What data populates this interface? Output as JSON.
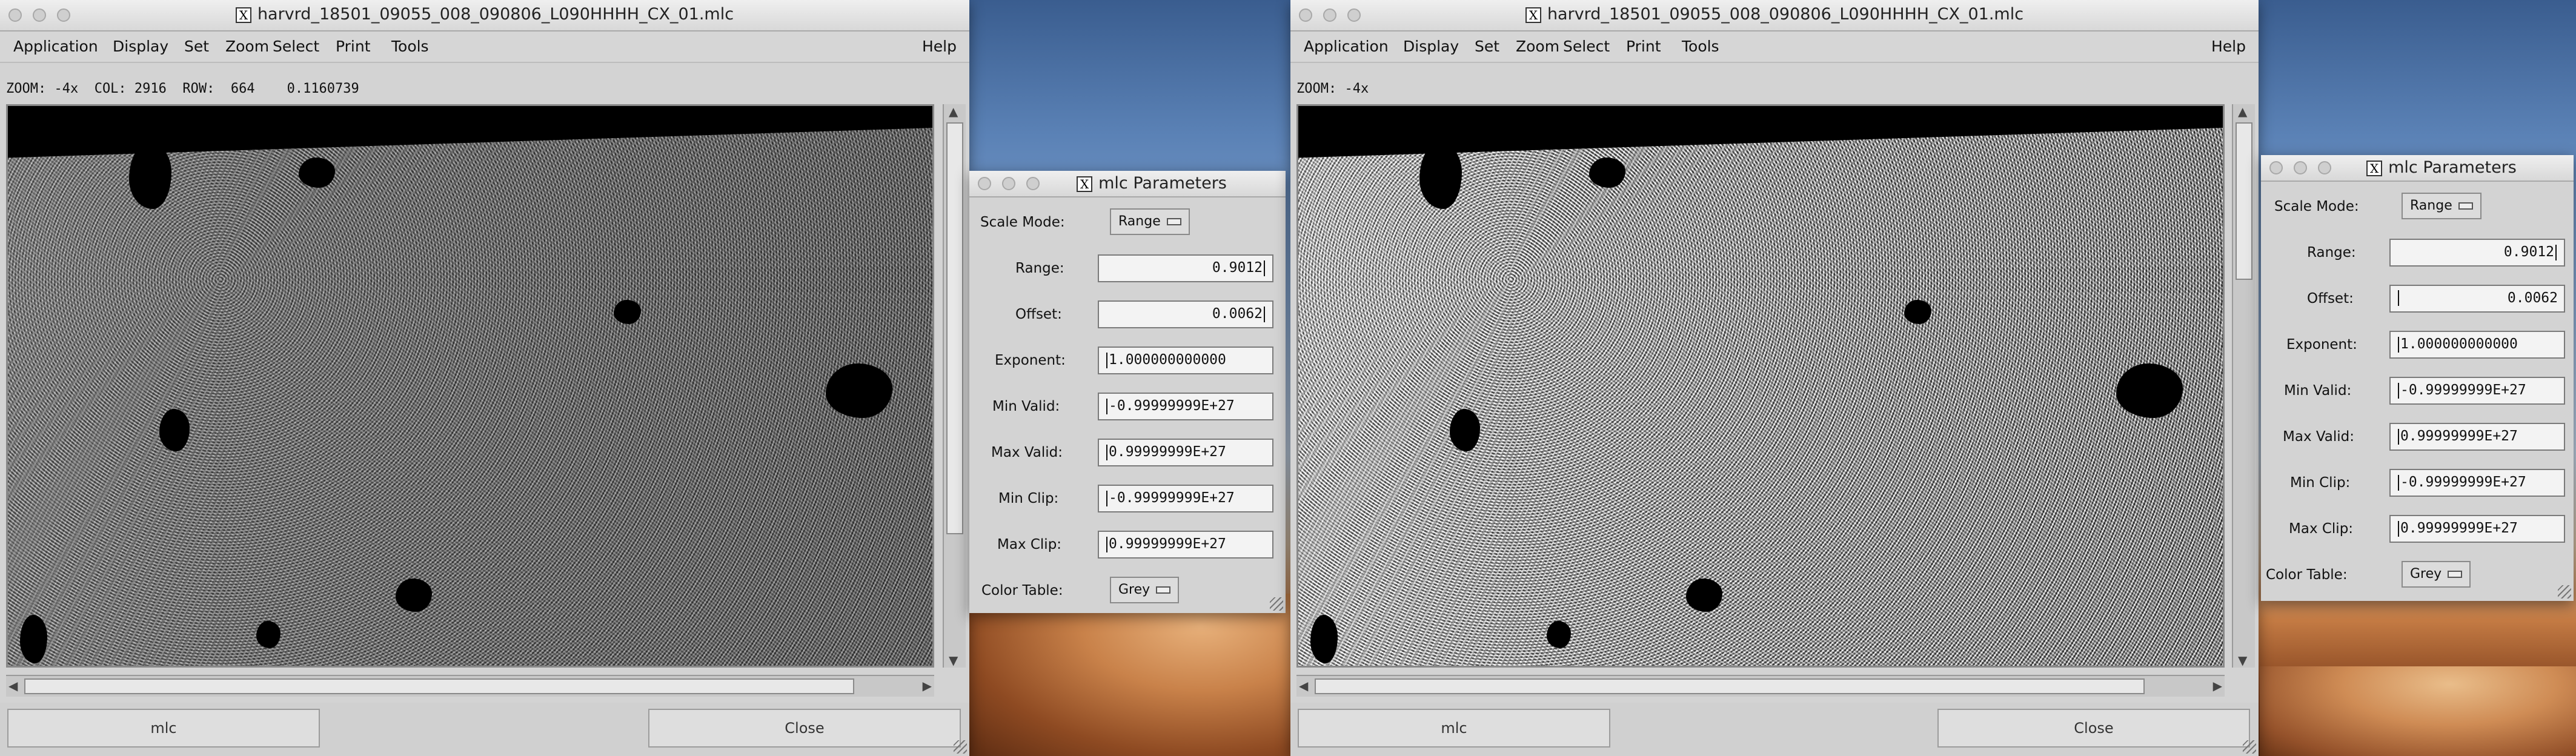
{
  "left_window": {
    "title": "harvrd_18501_09055_008_090806_L090HHHH_CX_01.mlc",
    "menu": [
      "Application",
      "Display",
      "Set",
      "Zoom",
      "Select",
      "Print",
      "Tools"
    ],
    "help": "Help",
    "info": "ZOOM: -4x  COL: 2916  ROW:  664    0.1160739",
    "buttons": {
      "left": "mlc",
      "right": "Close"
    }
  },
  "left_params": {
    "title": "mlc Parameters",
    "scale_mode_label": "Scale Mode:",
    "scale_mode_value": "Range",
    "range_label": "Range:",
    "range_value": "0.9012",
    "offset_label": "Offset:",
    "offset_value": "0.0062",
    "exponent_label": "Exponent:",
    "exponent_value": "1.000000000000",
    "min_valid_label": "Min Valid:",
    "min_valid_value": "-0.99999999E+27",
    "max_valid_label": "Max Valid:",
    "max_valid_value": "0.99999999E+27",
    "min_clip_label": "Min Clip:",
    "min_clip_value": "-0.99999999E+27",
    "max_clip_label": "Max Clip:",
    "max_clip_value": "0.99999999E+27",
    "color_table_label": "Color Table:",
    "color_table_value": "Grey"
  },
  "right_window": {
    "title": "harvrd_18501_09055_008_090806_L090HHHH_CX_01.mlc",
    "menu": [
      "Application",
      "Display",
      "Set",
      "Zoom",
      "Select",
      "Print",
      "Tools"
    ],
    "help": "Help",
    "info": "ZOOM: -4x",
    "buttons": {
      "left": "mlc",
      "right": "Close"
    }
  },
  "right_params": {
    "title": "mlc Parameters",
    "scale_mode_label": "Scale Mode:",
    "scale_mode_value": "Range",
    "range_label": "Range:",
    "range_value": "0.9012",
    "offset_label": "Offset:",
    "offset_value": "0.0062",
    "exponent_label": "Exponent:",
    "exponent_value": "1.000000000000",
    "min_valid_label": "Min Valid:",
    "min_valid_value": "-0.99999999E+27",
    "max_valid_label": "Max Valid:",
    "max_valid_value": "0.99999999E+27",
    "min_clip_label": "Min Clip:",
    "min_clip_value": "-0.99999999E+27",
    "max_clip_label": "Max Clip:",
    "max_clip_value": "0.99999999E+27",
    "color_table_label": "Color Table:",
    "color_table_value": "Grey"
  },
  "icons": {
    "window_app": "x11-icon",
    "traffic": "window-control-icon",
    "dropdown": "option-menu-indicator-icon"
  }
}
